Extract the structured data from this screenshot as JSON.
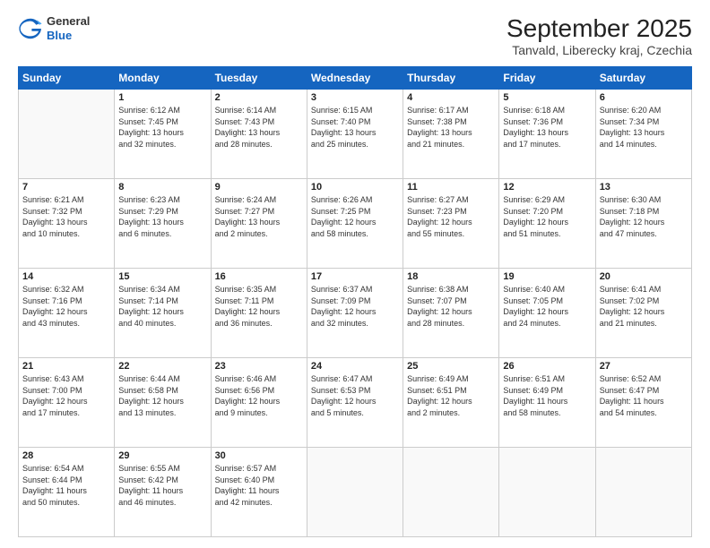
{
  "header": {
    "logo_general": "General",
    "logo_blue": "Blue",
    "title": "September 2025",
    "subtitle": "Tanvald, Liberecky kraj, Czechia"
  },
  "days_of_week": [
    "Sunday",
    "Monday",
    "Tuesday",
    "Wednesday",
    "Thursday",
    "Friday",
    "Saturday"
  ],
  "weeks": [
    [
      {
        "day": "",
        "info": ""
      },
      {
        "day": "1",
        "info": "Sunrise: 6:12 AM\nSunset: 7:45 PM\nDaylight: 13 hours\nand 32 minutes."
      },
      {
        "day": "2",
        "info": "Sunrise: 6:14 AM\nSunset: 7:43 PM\nDaylight: 13 hours\nand 28 minutes."
      },
      {
        "day": "3",
        "info": "Sunrise: 6:15 AM\nSunset: 7:40 PM\nDaylight: 13 hours\nand 25 minutes."
      },
      {
        "day": "4",
        "info": "Sunrise: 6:17 AM\nSunset: 7:38 PM\nDaylight: 13 hours\nand 21 minutes."
      },
      {
        "day": "5",
        "info": "Sunrise: 6:18 AM\nSunset: 7:36 PM\nDaylight: 13 hours\nand 17 minutes."
      },
      {
        "day": "6",
        "info": "Sunrise: 6:20 AM\nSunset: 7:34 PM\nDaylight: 13 hours\nand 14 minutes."
      }
    ],
    [
      {
        "day": "7",
        "info": "Sunrise: 6:21 AM\nSunset: 7:32 PM\nDaylight: 13 hours\nand 10 minutes."
      },
      {
        "day": "8",
        "info": "Sunrise: 6:23 AM\nSunset: 7:29 PM\nDaylight: 13 hours\nand 6 minutes."
      },
      {
        "day": "9",
        "info": "Sunrise: 6:24 AM\nSunset: 7:27 PM\nDaylight: 13 hours\nand 2 minutes."
      },
      {
        "day": "10",
        "info": "Sunrise: 6:26 AM\nSunset: 7:25 PM\nDaylight: 12 hours\nand 58 minutes."
      },
      {
        "day": "11",
        "info": "Sunrise: 6:27 AM\nSunset: 7:23 PM\nDaylight: 12 hours\nand 55 minutes."
      },
      {
        "day": "12",
        "info": "Sunrise: 6:29 AM\nSunset: 7:20 PM\nDaylight: 12 hours\nand 51 minutes."
      },
      {
        "day": "13",
        "info": "Sunrise: 6:30 AM\nSunset: 7:18 PM\nDaylight: 12 hours\nand 47 minutes."
      }
    ],
    [
      {
        "day": "14",
        "info": "Sunrise: 6:32 AM\nSunset: 7:16 PM\nDaylight: 12 hours\nand 43 minutes."
      },
      {
        "day": "15",
        "info": "Sunrise: 6:34 AM\nSunset: 7:14 PM\nDaylight: 12 hours\nand 40 minutes."
      },
      {
        "day": "16",
        "info": "Sunrise: 6:35 AM\nSunset: 7:11 PM\nDaylight: 12 hours\nand 36 minutes."
      },
      {
        "day": "17",
        "info": "Sunrise: 6:37 AM\nSunset: 7:09 PM\nDaylight: 12 hours\nand 32 minutes."
      },
      {
        "day": "18",
        "info": "Sunrise: 6:38 AM\nSunset: 7:07 PM\nDaylight: 12 hours\nand 28 minutes."
      },
      {
        "day": "19",
        "info": "Sunrise: 6:40 AM\nSunset: 7:05 PM\nDaylight: 12 hours\nand 24 minutes."
      },
      {
        "day": "20",
        "info": "Sunrise: 6:41 AM\nSunset: 7:02 PM\nDaylight: 12 hours\nand 21 minutes."
      }
    ],
    [
      {
        "day": "21",
        "info": "Sunrise: 6:43 AM\nSunset: 7:00 PM\nDaylight: 12 hours\nand 17 minutes."
      },
      {
        "day": "22",
        "info": "Sunrise: 6:44 AM\nSunset: 6:58 PM\nDaylight: 12 hours\nand 13 minutes."
      },
      {
        "day": "23",
        "info": "Sunrise: 6:46 AM\nSunset: 6:56 PM\nDaylight: 12 hours\nand 9 minutes."
      },
      {
        "day": "24",
        "info": "Sunrise: 6:47 AM\nSunset: 6:53 PM\nDaylight: 12 hours\nand 5 minutes."
      },
      {
        "day": "25",
        "info": "Sunrise: 6:49 AM\nSunset: 6:51 PM\nDaylight: 12 hours\nand 2 minutes."
      },
      {
        "day": "26",
        "info": "Sunrise: 6:51 AM\nSunset: 6:49 PM\nDaylight: 11 hours\nand 58 minutes."
      },
      {
        "day": "27",
        "info": "Sunrise: 6:52 AM\nSunset: 6:47 PM\nDaylight: 11 hours\nand 54 minutes."
      }
    ],
    [
      {
        "day": "28",
        "info": "Sunrise: 6:54 AM\nSunset: 6:44 PM\nDaylight: 11 hours\nand 50 minutes."
      },
      {
        "day": "29",
        "info": "Sunrise: 6:55 AM\nSunset: 6:42 PM\nDaylight: 11 hours\nand 46 minutes."
      },
      {
        "day": "30",
        "info": "Sunrise: 6:57 AM\nSunset: 6:40 PM\nDaylight: 11 hours\nand 42 minutes."
      },
      {
        "day": "",
        "info": ""
      },
      {
        "day": "",
        "info": ""
      },
      {
        "day": "",
        "info": ""
      },
      {
        "day": "",
        "info": ""
      }
    ]
  ]
}
